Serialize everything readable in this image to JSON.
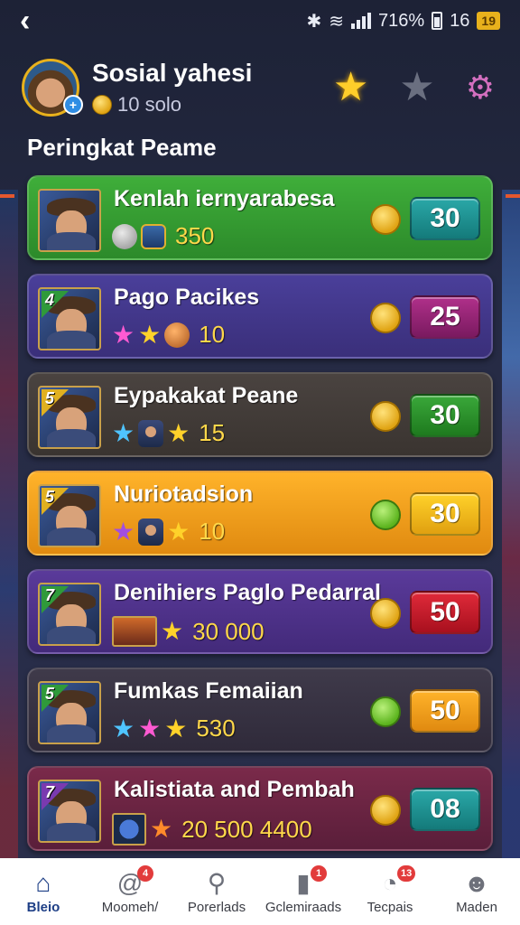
{
  "status_bar": {
    "battery_text": "716%",
    "time": "16",
    "badge": "19"
  },
  "header": {
    "title": "Sosial yahesi",
    "coins": "10 solo"
  },
  "section_title": "Peringkat Peame",
  "colors": {
    "background": "#262b45",
    "gold": "#ffce2a",
    "nav_active": "#1e3f86"
  },
  "players": [
    {
      "rank": "",
      "name": "Kenlah iernyarabesa",
      "meta_value": "350",
      "score": "30",
      "card_bg": "linear-gradient(180deg,#3fae3a,#2c8a2a)",
      "score_bg": "linear-gradient(#2aa8a8,#147a7a)",
      "coin": "gold",
      "flag": "#2f9a3a",
      "meta_icons": [
        "chip-gray",
        "chip-shield"
      ]
    },
    {
      "rank": "4",
      "name": "Pago Pacikes",
      "meta_value": "10",
      "score": "25",
      "card_bg": "linear-gradient(180deg,#4a3f9a,#3a2f7a)",
      "score_bg": "linear-gradient(#b0308a,#7a1a60)",
      "coin": "gold",
      "flag": "#2f9a3a",
      "meta_icons": [
        "star-pink",
        "star-gold",
        "chip-bronze"
      ]
    },
    {
      "rank": "5",
      "name": "Eypakakat Peane",
      "meta_value": "15",
      "score": "30",
      "card_bg": "linear-gradient(180deg,#4a4340,#3a3430)",
      "score_bg": "linear-gradient(#3aa83a,#1e7a1e)",
      "coin": "gold",
      "flag": "#e0b020",
      "meta_icons": [
        "star-blue",
        "mini-av",
        "star-gold"
      ]
    },
    {
      "rank": "5",
      "name": "Nuriotadsion",
      "meta_value": "10",
      "score": "30",
      "card_bg": "linear-gradient(180deg,#ffb32a,#e08a10)",
      "score_bg": "linear-gradient(#ffd22a,#e0a010)",
      "coin": "green",
      "flag": "#e0b020",
      "meta_icons": [
        "star-purple",
        "mini-av",
        "star-gold"
      ]
    },
    {
      "rank": "7",
      "name": "Denihiers Paglo Pedarral",
      "meta_value": "30 000",
      "score": "50",
      "card_bg": "linear-gradient(180deg,#5a3a9a,#432a7a)",
      "score_bg": "linear-gradient(#e02a3a,#a8101e)",
      "coin": "gold",
      "flag": "#2f9a3a",
      "meta_icons": [
        "mini-pic",
        "star-gold"
      ]
    },
    {
      "rank": "5",
      "name": "Fumkas Femaiian",
      "meta_value": "530",
      "score": "50",
      "card_bg": "linear-gradient(180deg,#3f3a4a,#2f2a3a)",
      "score_bg": "linear-gradient(#ffb32a,#e08a10)",
      "coin": "green",
      "flag": "#2f9a3a",
      "meta_icons": [
        "star-blue",
        "star-pink",
        "star-gold"
      ]
    },
    {
      "rank": "7",
      "name": "Kalistiata  and Pembah",
      "meta_value": "20  500 4400",
      "score": "08",
      "card_bg": "linear-gradient(180deg,#7a2a4a,#5a1e3a)",
      "score_bg": "linear-gradient(#2aa8a8,#147a7a)",
      "coin": "gold",
      "flag": "#7a3ab0",
      "meta_icons": [
        "mini-disc",
        "star-orange"
      ]
    }
  ],
  "bottom_nav": [
    {
      "label": "Bleio",
      "icon": "home-icon",
      "badge": "",
      "active": true
    },
    {
      "label": "Moomeh/",
      "icon": "at-sign-icon",
      "badge": "4",
      "active": false
    },
    {
      "label": "Porerlads",
      "icon": "location-pin-icon",
      "badge": "",
      "active": false
    },
    {
      "label": "Gclemiraads",
      "icon": "chat-icon",
      "badge": "1",
      "active": false
    },
    {
      "label": "Tecpais",
      "icon": "compass-icon",
      "badge": "13",
      "active": false
    },
    {
      "label": "Maden",
      "icon": "profile-icon",
      "badge": "",
      "active": false
    }
  ]
}
